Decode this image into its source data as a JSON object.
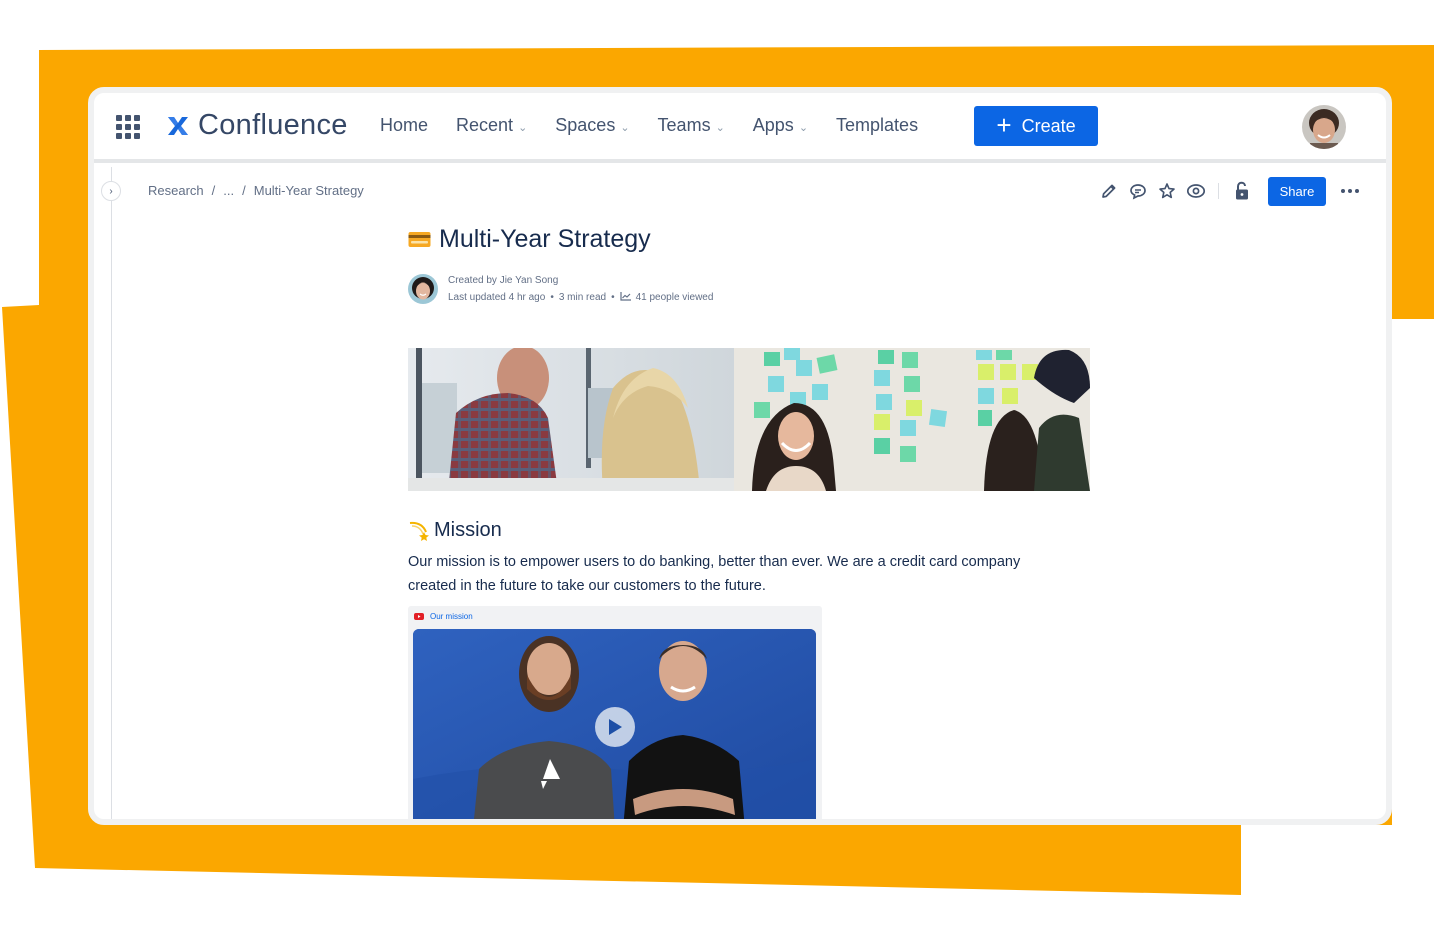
{
  "colors": {
    "accent_orange": "#FBA700",
    "primary_blue": "#0C66E4",
    "text_primary": "#172B4D",
    "text_secondary": "#44546F",
    "text_subtle": "#626F86"
  },
  "topnav": {
    "app_switcher_icon": "grid-icon",
    "logo_text": "Confluence",
    "items": [
      {
        "label": "Home",
        "has_dropdown": false
      },
      {
        "label": "Recent",
        "has_dropdown": true
      },
      {
        "label": "Spaces",
        "has_dropdown": true
      },
      {
        "label": "Teams",
        "has_dropdown": true
      },
      {
        "label": "Apps",
        "has_dropdown": true
      },
      {
        "label": "Templates",
        "has_dropdown": false
      }
    ],
    "create_label": "Create",
    "create_icon": "+"
  },
  "breadcrumb": {
    "items": [
      "Research",
      "...",
      "Multi-Year Strategy"
    ],
    "separator": "/"
  },
  "toolbar": {
    "icons": [
      "edit-icon",
      "comment-icon",
      "star-icon",
      "watch-icon",
      "unlock-icon"
    ],
    "share_label": "Share",
    "more_icon": "more-icon"
  },
  "page": {
    "title_emoji": "credit-card-icon",
    "title": "Multi-Year Strategy",
    "byline": {
      "created_by": "Created by Jie Yan Song",
      "last_updated": "Last updated 4 hr ago",
      "read_time": "3 min read",
      "views": "41 people viewed",
      "dot": "•"
    },
    "mission_heading": "Mission",
    "mission_emoji": "dizzy-star-icon",
    "mission_text": "Our mission is to empower users to do banking, better than ever. We are a credit card company created in the future to take our customers to the future.",
    "video": {
      "label": "Our mission",
      "source_icon": "youtube-icon"
    }
  }
}
